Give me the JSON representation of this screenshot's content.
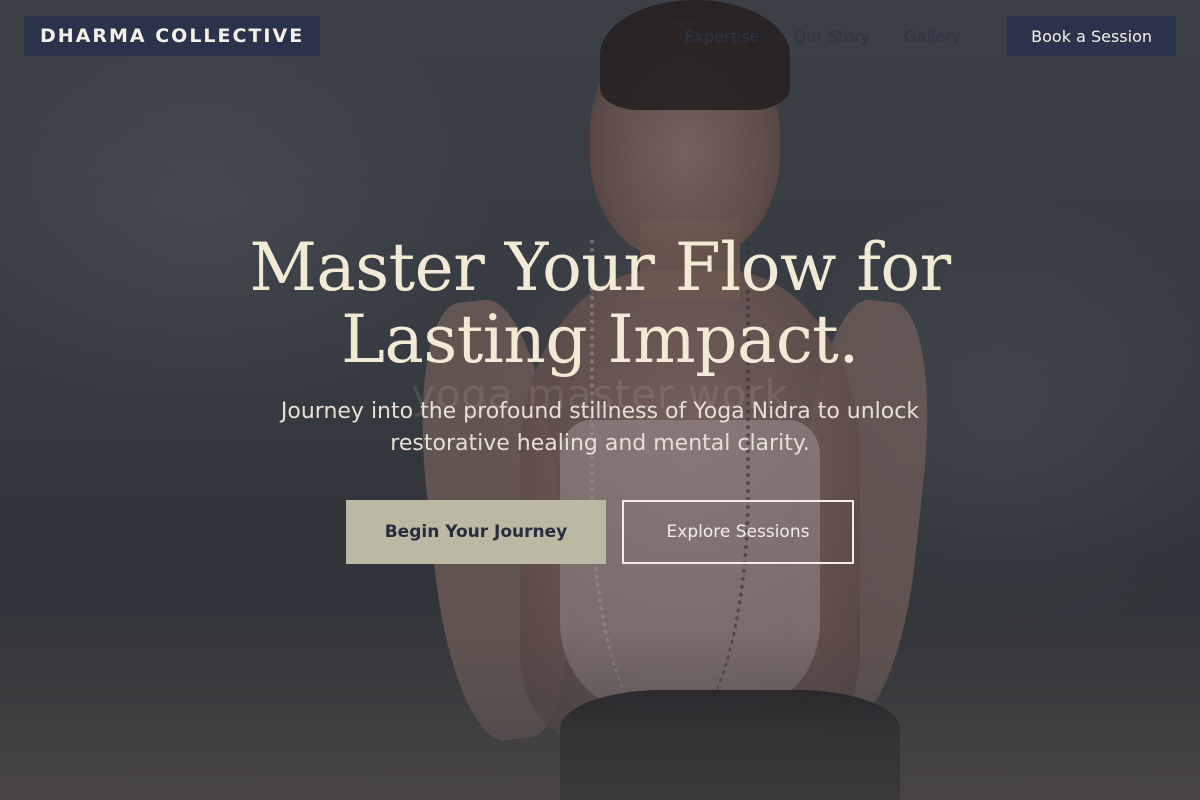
{
  "header": {
    "brand": "DHARMA COLLECTIVE",
    "nav": [
      {
        "label": "Expertise"
      },
      {
        "label": "Our Story"
      },
      {
        "label": "Gallery"
      }
    ],
    "cta_label": "Book a Session"
  },
  "hero": {
    "headline_line1": "Master Your Flow for",
    "headline_line2": "Lasting Impact.",
    "ghost_text": "yoga master work",
    "subheading": "Journey into the profound stillness of Yoga Nidra to unlock restorative healing and mental clarity.",
    "primary_button": "Begin Your Journey",
    "secondary_button": "Explore Sessions"
  },
  "colors": {
    "navy": "#2a334a",
    "cream": "#f3ead6",
    "sage": "#bbb9a4"
  }
}
